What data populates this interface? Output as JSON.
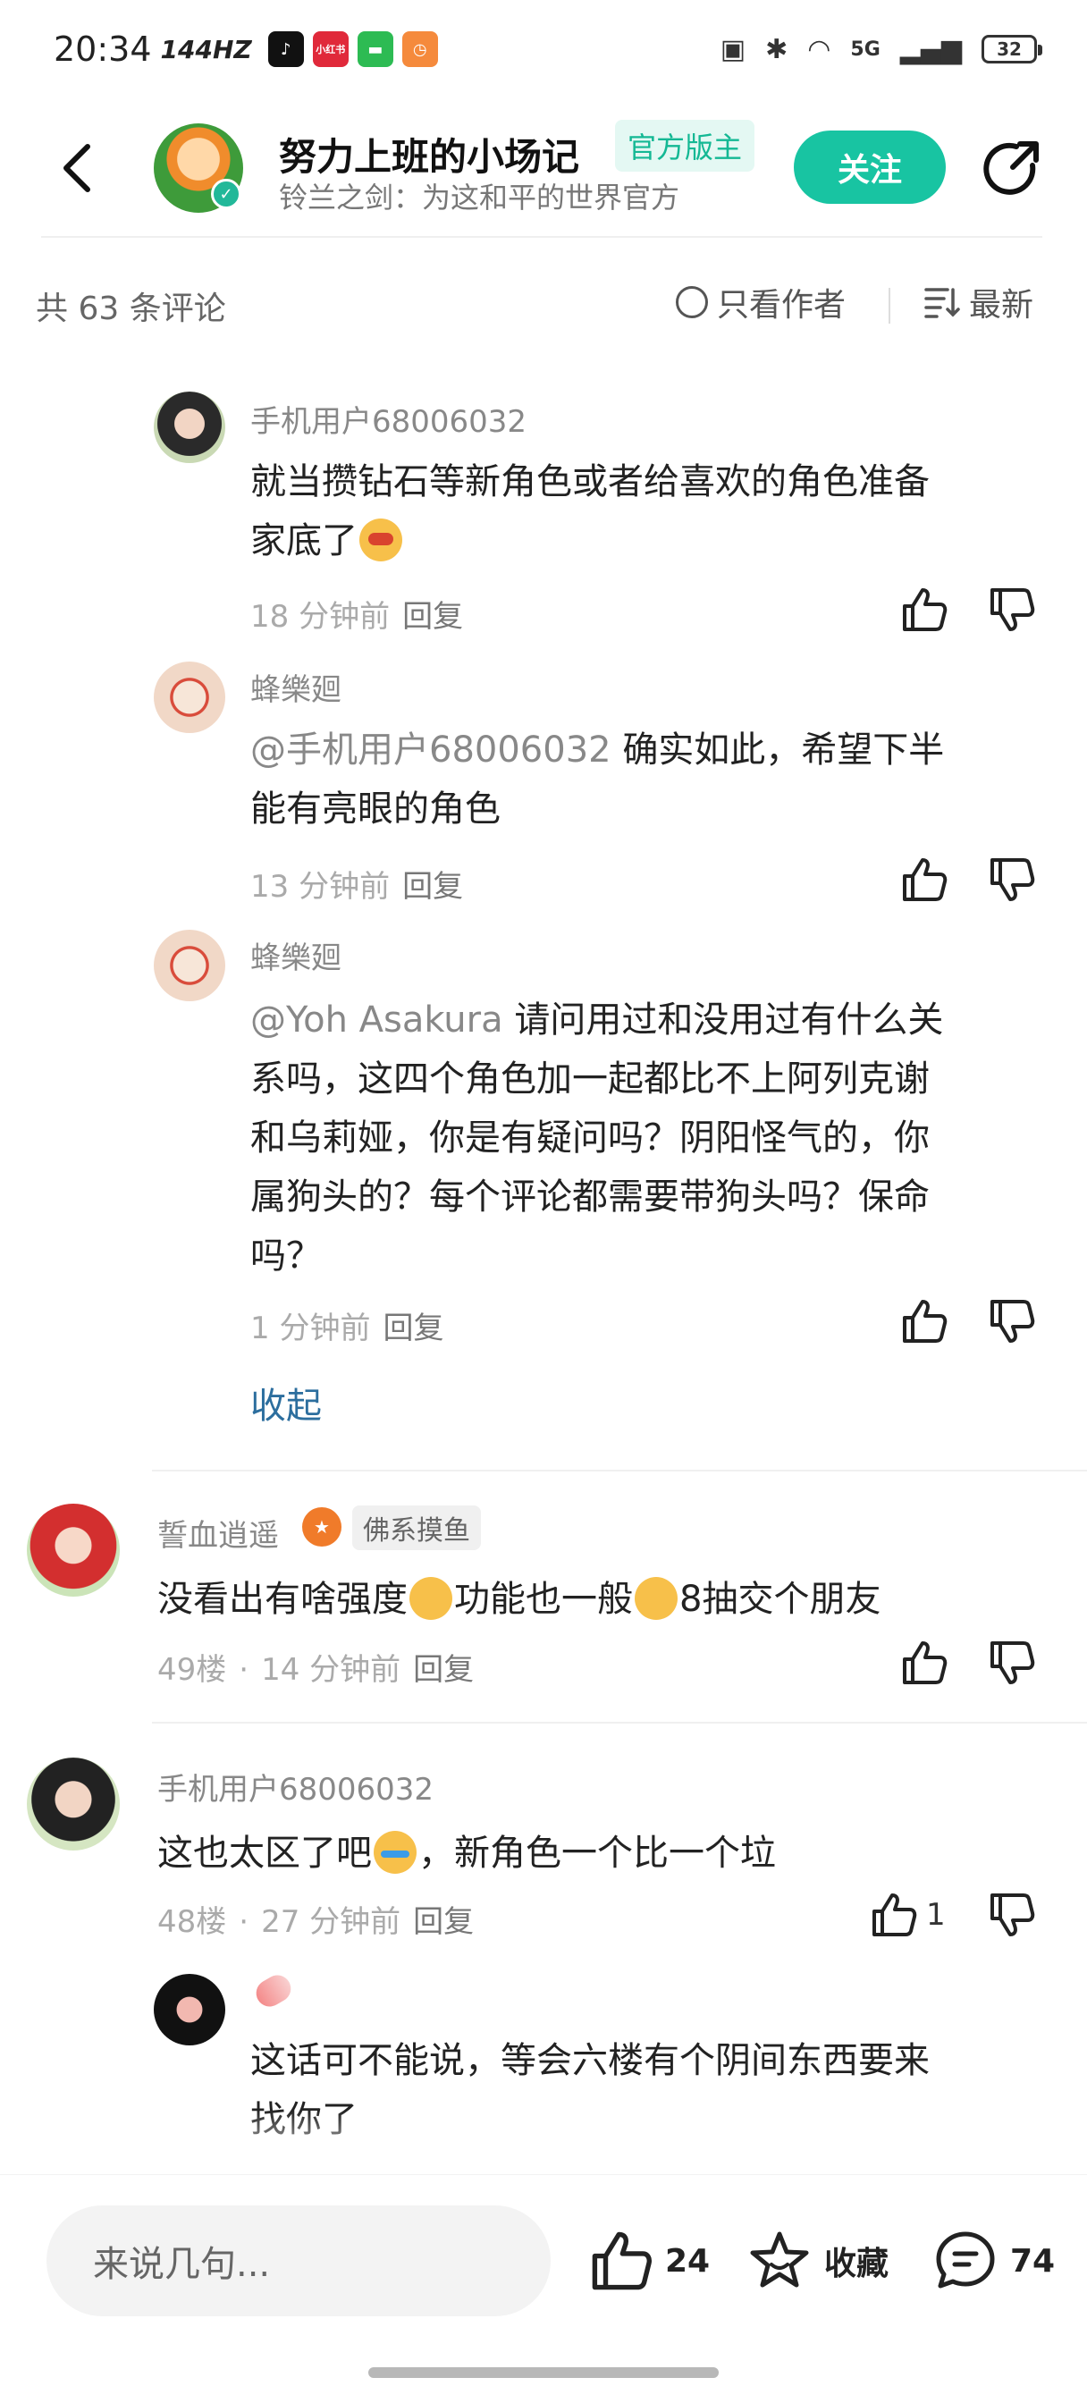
{
  "status_bar": {
    "time": "20:34",
    "hz": "144HZ",
    "apps": [
      {
        "name": "douyin-icon",
        "color": "#111111",
        "glyph": "♪"
      },
      {
        "name": "xiaohongshu-icon",
        "color": "#e0293a",
        "glyph": "小红书"
      },
      {
        "name": "chat-app-icon",
        "color": "#2dbb53",
        "glyph": "▬"
      },
      {
        "name": "timer-app-icon",
        "color": "#f58a3c",
        "glyph": "◷"
      }
    ],
    "battery": "32",
    "network": "5G"
  },
  "header": {
    "author_name": "努力上班的小场记",
    "official_badge": "官方版主",
    "subtitle": "铃兰之剑：为这和平的世界官方",
    "follow_label": "关注"
  },
  "comments_bar": {
    "count_label": "共 63 条评论",
    "only_author_label": "只看作者",
    "sort_label": "最新"
  },
  "comments": {
    "c1": {
      "user": "手机用户68006032",
      "text_line1": "就当攒钻石等新角色或者给喜欢的角色准备",
      "text_line2": "家底了",
      "time": "18 分钟前",
      "reply": "回复"
    },
    "c2": {
      "user": "蜂樂廻",
      "mention": "@手机用户68006032",
      "text_line1": "确实如此，希望下半",
      "text_line2": "能有亮眼的角色",
      "time": "13 分钟前",
      "reply": "回复"
    },
    "c3": {
      "user": "蜂樂廻",
      "mention": "@Yoh Asakura",
      "text_line1": "请问用过和没用过有什么关",
      "text_line2": "系吗，这四个角色加一起都比不上阿列克谢",
      "text_line3": "和乌莉娅，你是有疑问吗？阴阳怪气的，你",
      "text_line4": "属狗头的？每个评论都需要带狗头吗？保命",
      "text_line5": "吗？",
      "time": "1 分钟前",
      "reply": "回复"
    },
    "collapse_label": "收起",
    "c4": {
      "user": "誓血逍遥",
      "tag": "佛系摸鱼",
      "text_a": "没看出有啥强度",
      "text_b": "功能也一般",
      "text_c": "8抽交个朋友",
      "floor": "49楼",
      "time": "14 分钟前",
      "reply": "回复"
    },
    "c5": {
      "user": "手机用户68006032",
      "text_a": "这也太区了吧",
      "text_b": "，新角色一个比一个垃",
      "floor": "48楼",
      "time": "27 分钟前",
      "reply": "回复",
      "likes": "1"
    },
    "c6": {
      "text_line1": "这话可不能说，等会六楼有个阴间东西要来",
      "text_line2": "找你了"
    }
  },
  "bottom_bar": {
    "input_placeholder": "来说几句...",
    "likes": "24",
    "collect_label": "收藏",
    "comments": "74"
  },
  "colors": {
    "accent": "#18c4a2",
    "official_badge_bg": "#e4f8f3",
    "link": "#2c6e9e"
  }
}
